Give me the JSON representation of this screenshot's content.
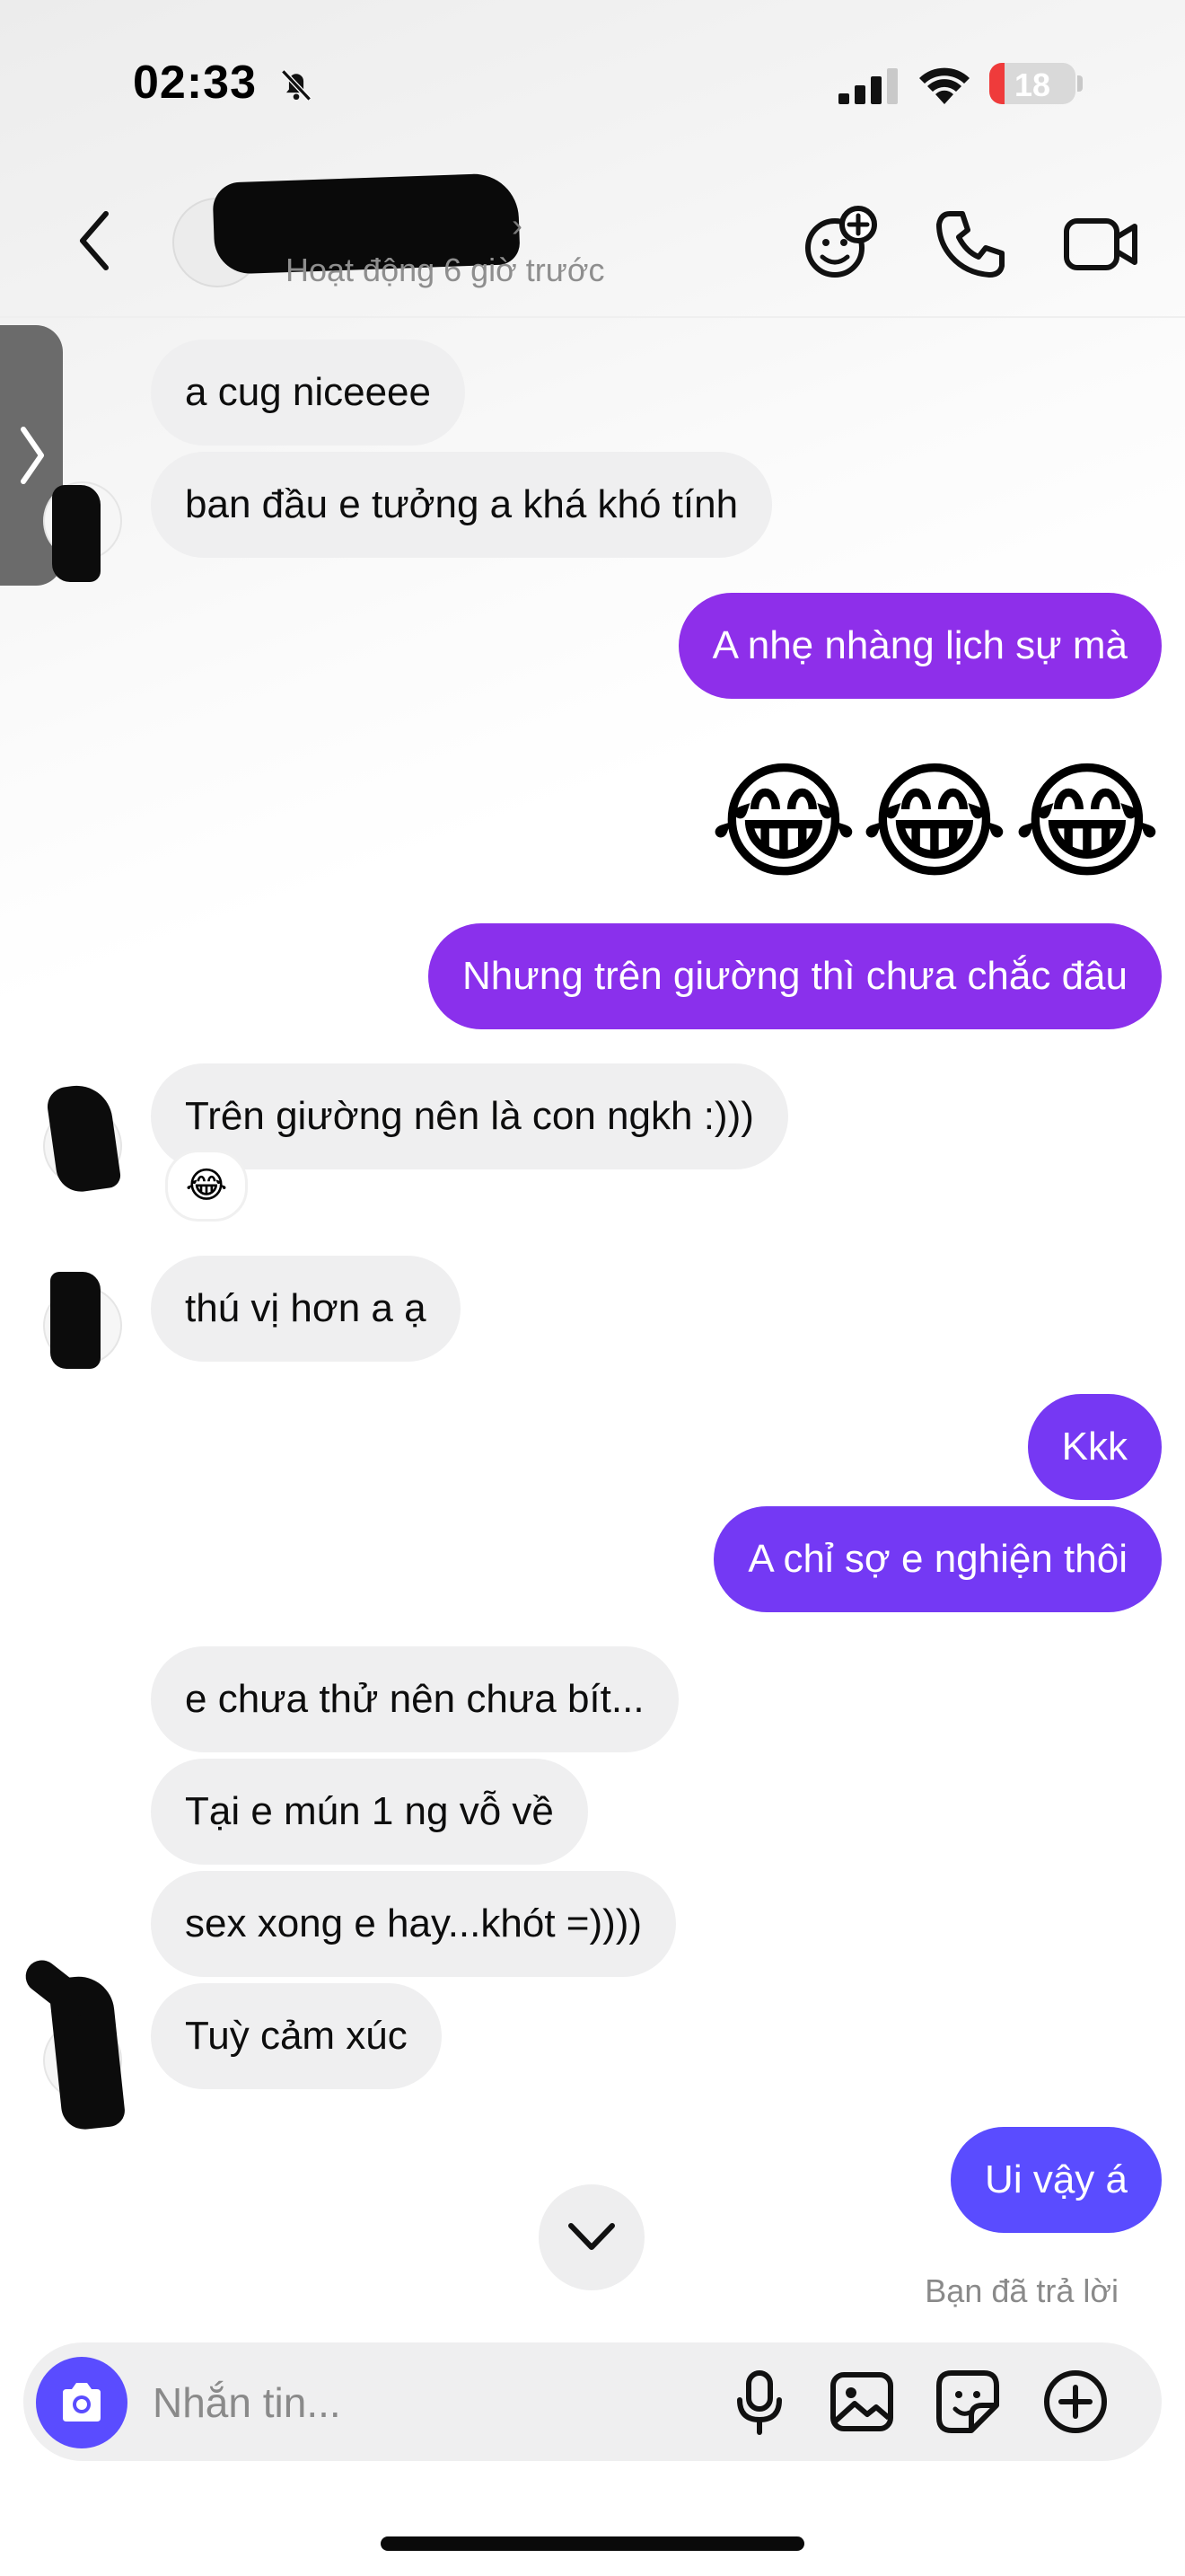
{
  "status_bar": {
    "time": "02:33",
    "battery": "18",
    "battery_fraction": 0.18
  },
  "header": {
    "contact_name": "",
    "contact_status": "Hoạt động 6 giờ trước",
    "icons": [
      "chevron-left-icon",
      "emoji-add-icon",
      "phone-icon",
      "video-camera-icon"
    ]
  },
  "messages": [
    {
      "side": "in",
      "text": "a cug niceeee"
    },
    {
      "side": "in",
      "text": "ban đầu e tưởng a khá khó tính"
    },
    {
      "side": "out",
      "text": "A nhẹ nhàng lịch sự mà"
    },
    {
      "side": "out",
      "text": "😂😂😂"
    },
    {
      "side": "out",
      "text": "Nhưng trên giường thì chưa chắc đâu"
    },
    {
      "side": "in",
      "text": "Trên giường nên là con ngkh :)))",
      "reaction": "😂"
    },
    {
      "side": "in",
      "text": "thú vị hơn a ạ"
    },
    {
      "side": "out",
      "text": "Kkk"
    },
    {
      "side": "out",
      "text": "A chỉ sợ e nghiện thôi"
    },
    {
      "side": "in",
      "text": "e chưa thử nên chưa bít..."
    },
    {
      "side": "in",
      "text": "Tại e mún 1 ng vỗ về"
    },
    {
      "side": "in",
      "text": "sex xong e hay...khót =))))"
    },
    {
      "side": "in",
      "text": "Tuỳ cảm xúc"
    },
    {
      "side": "out",
      "text": "Ui vậy á"
    }
  ],
  "seen_text": "Bạn đã trả lời",
  "composer": {
    "placeholder": "Nhắn tin...",
    "icons": [
      "camera-icon",
      "microphone-icon",
      "image-icon",
      "sticker-icon",
      "plus-icon"
    ]
  },
  "colors": {
    "outgoing_gradient": [
      "#9a2ce6",
      "#7f37f2",
      "#5a4cff"
    ],
    "incoming": "#efeff0",
    "accent": "#5a4cff"
  }
}
